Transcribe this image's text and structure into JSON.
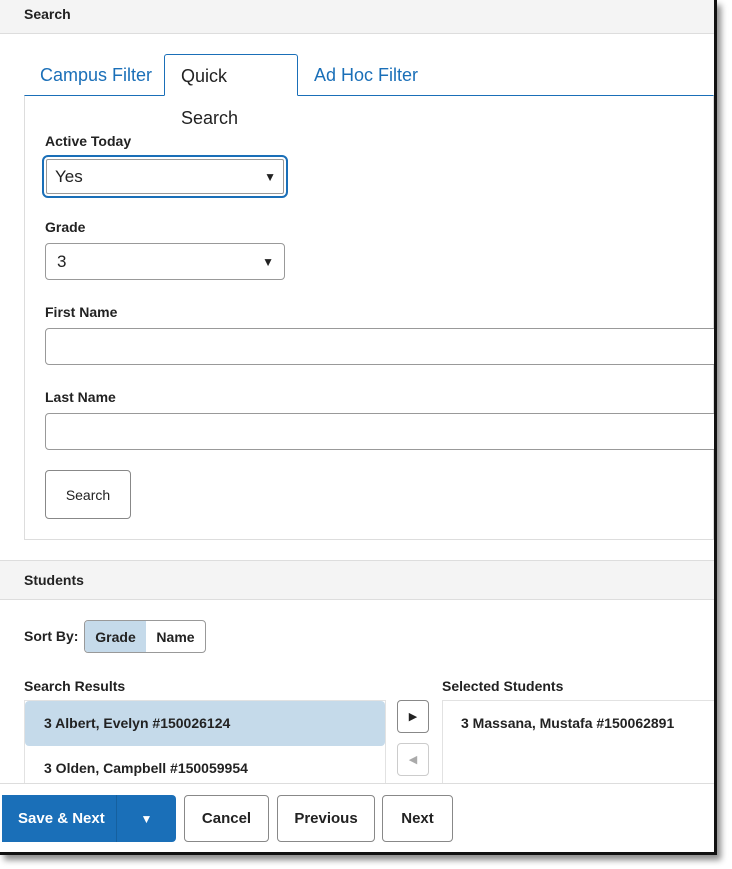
{
  "search": {
    "title": "Search",
    "tabs": [
      {
        "label": "Campus Filter"
      },
      {
        "label": "Quick Search"
      },
      {
        "label": "Ad Hoc Filter"
      }
    ],
    "active_today": {
      "label": "Active Today",
      "value": "Yes"
    },
    "grade": {
      "label": "Grade",
      "value": "3"
    },
    "first_name": {
      "label": "First Name",
      "value": ""
    },
    "last_name": {
      "label": "Last Name",
      "value": ""
    },
    "search_button": "Search"
  },
  "students": {
    "title": "Students",
    "sort_by": "Sort By:",
    "sort_options": [
      "Grade",
      "Name"
    ],
    "sort_selected": "Grade",
    "results_label": "Search Results",
    "results": [
      "3 Albert, Evelyn #150026124",
      "3 Olden, Campbell #150059954"
    ],
    "selected_label": "Selected Students",
    "selected": [
      "3 Massana, Mustafa #150062891"
    ]
  },
  "footer": {
    "save_next": "Save & Next",
    "cancel": "Cancel",
    "previous": "Previous",
    "next": "Next"
  },
  "colors": {
    "accent": "#1a6fb8",
    "selected_bg": "#c5daea"
  }
}
